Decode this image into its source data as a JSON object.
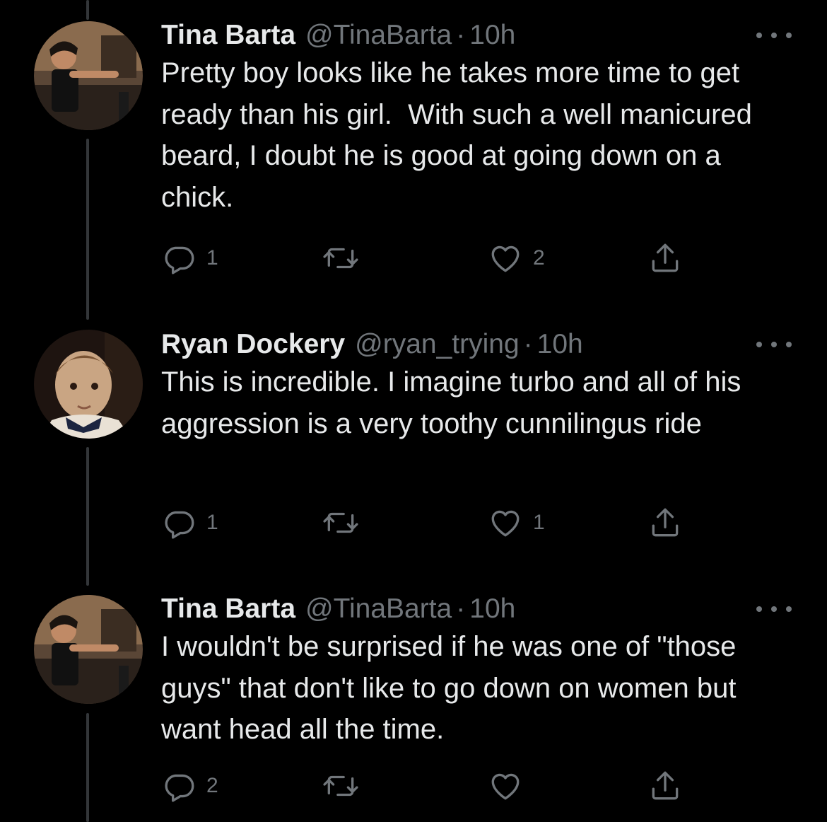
{
  "tweets": [
    {
      "name": "Tina Barta",
      "handle": "@TinaBarta",
      "separator": "·",
      "time": "10h",
      "text": "Pretty boy looks like he takes more time to get ready than his girl.  With such a well manicured beard, I doubt he is good at going down on a chick.",
      "replies": "1",
      "retweets": "",
      "likes": "2"
    },
    {
      "name": "Ryan Dockery",
      "handle": "@ryan_trying",
      "separator": "·",
      "time": "10h",
      "text": "This is incredible. I imagine turbo and all of his aggression is a very toothy cunnilingus ride",
      "replies": "1",
      "retweets": "",
      "likes": "1"
    },
    {
      "name": "Tina Barta",
      "handle": "@TinaBarta",
      "separator": "·",
      "time": "10h",
      "text": "I wouldn't be surprised if he was one of \"those guys\" that don't like to go down on women but want head all the time.",
      "replies": "2",
      "retweets": "",
      "likes": ""
    }
  ],
  "icons": {
    "reply": "reply-icon",
    "retweet": "retweet-icon",
    "like": "heart-icon",
    "share": "share-icon",
    "more": "more-options-icon"
  },
  "colors": {
    "background": "#000000",
    "primary_text": "#e7e9ea",
    "secondary_text": "#71767b",
    "thread_line": "#333639"
  }
}
